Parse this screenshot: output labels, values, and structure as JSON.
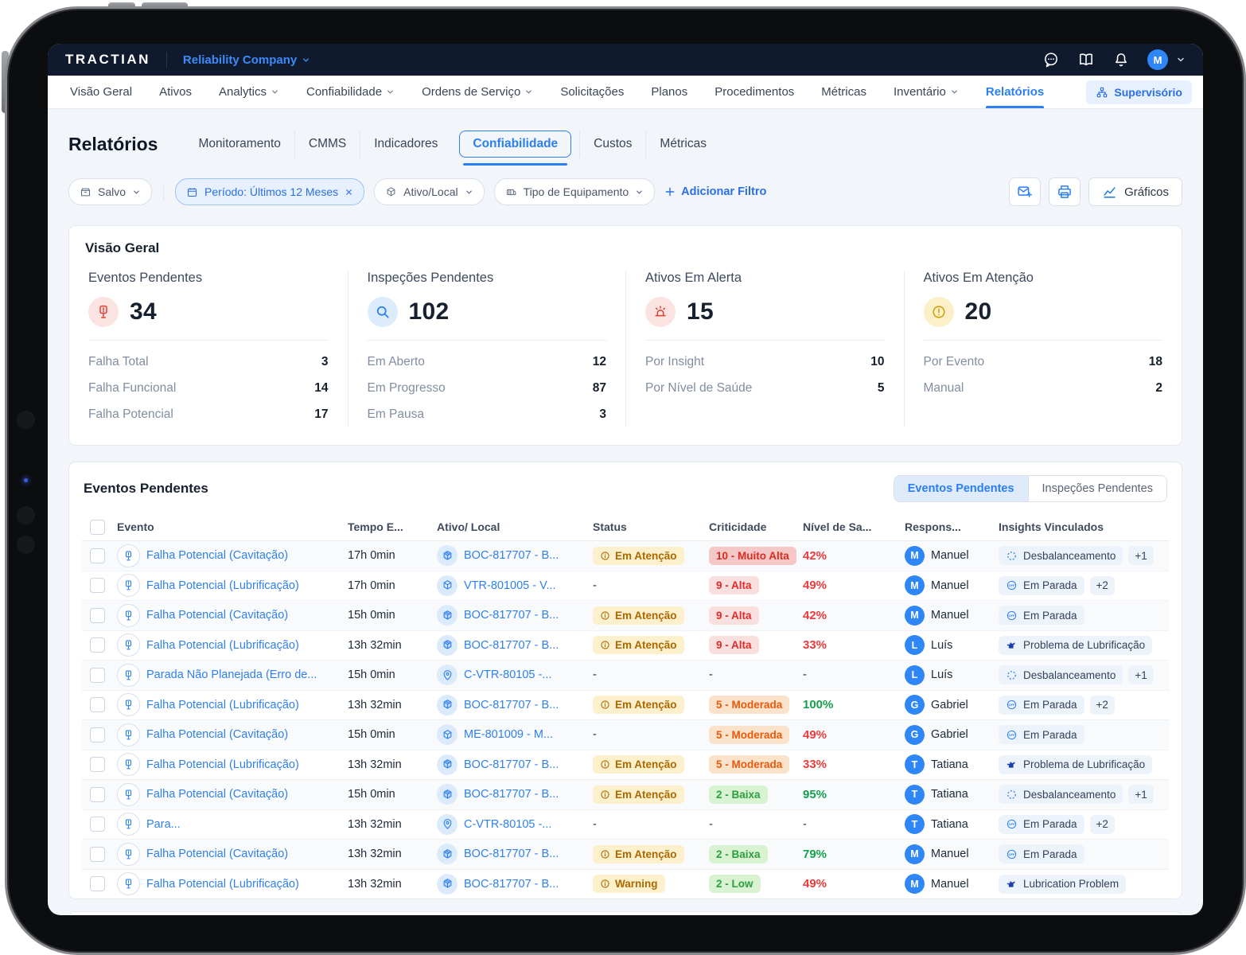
{
  "topbar": {
    "logo": "TRACTIAN",
    "company": "Reliability Company",
    "icons": [
      "chat-icon",
      "book-icon",
      "bell-icon"
    ],
    "avatar_initial": "M"
  },
  "nav": {
    "items": [
      {
        "label": "Visão Geral",
        "dropdown": false,
        "active": false
      },
      {
        "label": "Ativos",
        "dropdown": false,
        "active": false
      },
      {
        "label": "Analytics",
        "dropdown": true,
        "active": false
      },
      {
        "label": "Confiabilidade",
        "dropdown": true,
        "active": false
      },
      {
        "label": "Ordens de Serviço",
        "dropdown": true,
        "active": false
      },
      {
        "label": "Solicitações",
        "dropdown": false,
        "active": false
      },
      {
        "label": "Planos",
        "dropdown": false,
        "active": false
      },
      {
        "label": "Procedimentos",
        "dropdown": false,
        "active": false
      },
      {
        "label": "Métricas",
        "dropdown": false,
        "active": false
      },
      {
        "label": "Inventário",
        "dropdown": true,
        "active": false
      },
      {
        "label": "Relatórios",
        "dropdown": false,
        "active": true
      }
    ],
    "supervisorio_label": "Supervisório"
  },
  "page": {
    "title": "Relatórios",
    "tabs": [
      "Monitoramento",
      "CMMS",
      "Indicadores",
      "Confiabilidade",
      "Custos",
      "Métricas"
    ],
    "active_tab": "Confiabilidade"
  },
  "filters": {
    "saved_label": "Salvo",
    "period_chip": "Período:  Últimos 12 Meses",
    "asset_chip": "Ativo/Local",
    "equipment_chip": "Tipo de Equipamento",
    "add_filter_label": "Adicionar Filtro",
    "graficos_label": "Gráficos"
  },
  "overview": {
    "title": "Visão Geral",
    "cards": [
      {
        "label": "Eventos Pendentes",
        "value": "34",
        "icon": "sensor",
        "color": "red",
        "rows": [
          {
            "label": "Falha Total",
            "value": "3"
          },
          {
            "label": "Falha Funcional",
            "value": "14"
          },
          {
            "label": "Falha Potencial",
            "value": "17"
          }
        ]
      },
      {
        "label": "Inspeções Pendentes",
        "value": "102",
        "icon": "search",
        "color": "blue",
        "rows": [
          {
            "label": "Em Aberto",
            "value": "12"
          },
          {
            "label": "Em Progresso",
            "value": "87"
          },
          {
            "label": "Em Pausa",
            "value": "3"
          }
        ]
      },
      {
        "label": "Ativos Em Alerta",
        "value": "15",
        "icon": "siren",
        "color": "red",
        "rows": [
          {
            "label": "Por Insight",
            "value": "10"
          },
          {
            "label": "Por Nível de Saúde",
            "value": "5"
          }
        ]
      },
      {
        "label": "Ativos Em Atenção",
        "value": "20",
        "icon": "warning",
        "color": "yellow",
        "rows": [
          {
            "label": "Por Evento",
            "value": "18"
          },
          {
            "label": "Manual",
            "value": "2"
          }
        ]
      }
    ]
  },
  "events_table": {
    "title": "Eventos Pendentes",
    "toggle": [
      "Eventos Pendentes",
      "Inspeções Pendentes"
    ],
    "active_toggle": "Eventos Pendentes",
    "columns": [
      "Evento",
      "Tempo E...",
      "Ativo/ Local",
      "Status",
      "Criticidade",
      "Nível de Sa...",
      "Respons...",
      "Insights Vinculados"
    ],
    "rows": [
      {
        "event": "Falha Potencial (Cavitação)",
        "time": "17h 0min",
        "asset": "BOC-817707 - B...",
        "asset_icon": "cube-filled",
        "status": "Em Atenção",
        "criticality": "10 - Muito Alta",
        "crit_level": "very-high",
        "health": "42%",
        "health_state": "bad",
        "resp": "Manuel",
        "insights": [
          {
            "label": "Desbalanceamento",
            "icon": "dashed-circle"
          }
        ],
        "extra": "+1"
      },
      {
        "event": "Falha Potencial (Lubrificação)",
        "time": "17h 0min",
        "asset": "VTR-801005 - V...",
        "asset_icon": "cube-outline",
        "status": null,
        "criticality": "9 - Alta",
        "crit_level": "high",
        "health": "49%",
        "health_state": "bad",
        "resp": "Manuel",
        "insights": [
          {
            "label": "Em Parada",
            "icon": "off"
          }
        ],
        "extra": "+2"
      },
      {
        "event": "Falha Potencial (Cavitação)",
        "time": "15h 0min",
        "asset": "BOC-817707 - B...",
        "asset_icon": "cube-filled",
        "status": "Em Atenção",
        "criticality": "9 - Alta",
        "crit_level": "high",
        "health": "42%",
        "health_state": "bad",
        "resp": "Manuel",
        "insights": [
          {
            "label": "Em Parada",
            "icon": "off"
          }
        ],
        "extra": null
      },
      {
        "event": "Falha Potencial (Lubrificação)",
        "time": "13h 32min",
        "asset": "BOC-817707 - B...",
        "asset_icon": "cube-filled",
        "status": "Em Atenção",
        "criticality": "9 - Alta",
        "crit_level": "high",
        "health": "33%",
        "health_state": "bad",
        "resp": "Luís",
        "insights": [
          {
            "label": "Problema de Lubrificação",
            "icon": "oil"
          }
        ],
        "extra": null
      },
      {
        "event": "Parada Não Planejada (Erro de...",
        "time": "15h 0min",
        "asset": "C-VTR-80105 -...",
        "asset_icon": "pin",
        "status": null,
        "criticality": null,
        "crit_level": null,
        "health": null,
        "health_state": null,
        "resp": "Luís",
        "insights": [
          {
            "label": "Desbalanceamento",
            "icon": "dashed-circle"
          }
        ],
        "extra": "+1"
      },
      {
        "event": "Falha Potencial (Lubrificação)",
        "time": "13h 32min",
        "asset": "BOC-817707 - B...",
        "asset_icon": "cube-filled",
        "status": "Em Atenção",
        "criticality": "5 - Moderada",
        "crit_level": "moderate",
        "health": "100%",
        "health_state": "good",
        "resp": "Gabriel",
        "insights": [
          {
            "label": "Em Parada",
            "icon": "off"
          }
        ],
        "extra": "+2"
      },
      {
        "event": "Falha Potencial (Cavitação)",
        "time": "15h 0min",
        "asset": "ME-801009 - M...",
        "asset_icon": "cube-outline",
        "status": null,
        "criticality": "5 - Moderada",
        "crit_level": "moderate",
        "health": "49%",
        "health_state": "bad",
        "resp": "Gabriel",
        "insights": [
          {
            "label": "Em Parada",
            "icon": "off"
          }
        ],
        "extra": null
      },
      {
        "event": "Falha Potencial (Lubrificação)",
        "time": "13h 32min",
        "asset": "BOC-817707 - B...",
        "asset_icon": "cube-filled",
        "status": "Em Atenção",
        "criticality": "5 - Moderada",
        "crit_level": "moderate",
        "health": "33%",
        "health_state": "bad",
        "resp": "Tatiana",
        "insights": [
          {
            "label": "Problema de Lubrificação",
            "icon": "oil"
          }
        ],
        "extra": null
      },
      {
        "event": "Falha Potencial (Cavitação)",
        "time": "15h 0min",
        "asset": "BOC-817707 - B...",
        "asset_icon": "cube-filled",
        "status": "Em Atenção",
        "criticality": "2 - Baixa",
        "crit_level": "low",
        "health": "95%",
        "health_state": "good",
        "resp": "Tatiana",
        "insights": [
          {
            "label": "Desbalanceamento",
            "icon": "dashed-circle"
          }
        ],
        "extra": "+1"
      },
      {
        "event": "Para...",
        "time": "13h 32min",
        "asset": "C-VTR-80105 -...",
        "asset_icon": "pin",
        "status": null,
        "criticality": null,
        "crit_level": null,
        "health": null,
        "health_state": null,
        "resp": "Tatiana",
        "insights": [
          {
            "label": "Em Parada",
            "icon": "off"
          }
        ],
        "extra": "+2"
      },
      {
        "event": "Falha Potencial (Cavitação)",
        "time": "13h 32min",
        "asset": "BOC-817707 - B...",
        "asset_icon": "cube-filled",
        "status": "Em Atenção",
        "criticality": "2 - Baixa",
        "crit_level": "low",
        "health": "79%",
        "health_state": "good",
        "resp": "Manuel",
        "insights": [
          {
            "label": "Em Parada",
            "icon": "off"
          }
        ],
        "extra": null
      },
      {
        "event": "Falha Potencial (Lubrificação)",
        "time": "13h 32min",
        "asset": "BOC-817707 - B...",
        "asset_icon": "cube-filled",
        "status": "Warning",
        "criticality": "2 - Low",
        "crit_level": "low",
        "health": "49%",
        "health_state": "bad",
        "resp": "Manuel",
        "insights": [
          {
            "label": "Lubrication Problem",
            "icon": "oil"
          }
        ],
        "extra": null
      }
    ]
  },
  "colors": {
    "accent_blue": "#2b7ff2",
    "navy_topbar": "#101a2e",
    "status_yellow_bg": "#fcf0cd",
    "crit_red_bg": "#f6c7c7",
    "crit_green_bg": "#d9f3d2",
    "health_red": "#ee3a3a",
    "health_green": "#12a04c"
  }
}
